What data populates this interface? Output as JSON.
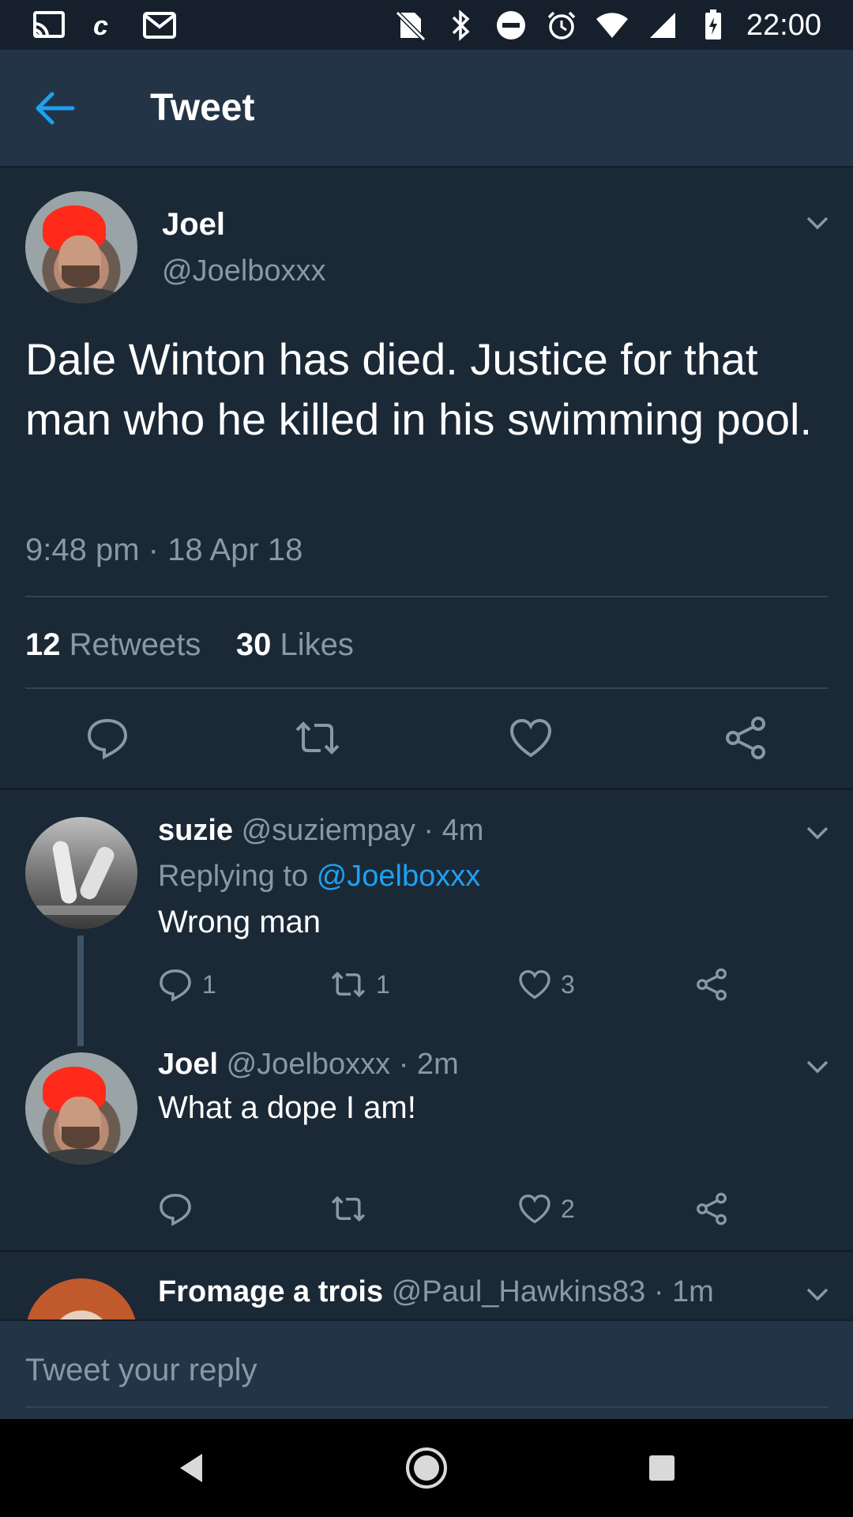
{
  "status_bar": {
    "time": "22:00",
    "left_icons": [
      "cast-icon",
      "c-app-icon",
      "gmail-icon"
    ],
    "right_icons": [
      "no-sim-icon",
      "bluetooth-icon",
      "do-not-disturb-icon",
      "alarm-icon",
      "wifi-icon",
      "signal-icon",
      "battery-charging-icon"
    ]
  },
  "app_bar": {
    "title": "Tweet",
    "back_icon": "back-arrow-icon",
    "accent": "#1da1f2"
  },
  "tweet": {
    "author_name": "Joel",
    "author_handle": "@Joelboxxx",
    "text": "Dale Winton has died. Justice for that man who he killed in his swimming pool.",
    "timestamp": "9:48 pm · 18 Apr 18",
    "retweets_count": "12",
    "retweets_label": "Retweets",
    "likes_count": "30",
    "likes_label": "Likes",
    "actions": [
      "reply-icon",
      "retweet-icon",
      "like-icon",
      "share-icon"
    ]
  },
  "replies": [
    {
      "name": "suzie",
      "handle": "@suziempay · 4m",
      "replying_prefix": "Replying to",
      "replying_to": "@Joelboxxx",
      "text": "Wrong man",
      "reply_count": "1",
      "retweet_count": "1",
      "like_count": "3"
    },
    {
      "name": "Joel",
      "handle": "@Joelboxxx · 2m",
      "text": "What a dope I am!",
      "reply_count": "",
      "retweet_count": "",
      "like_count": "2"
    },
    {
      "name": "Fromage a trois",
      "handle": "@Paul_Hawkins83 · 1m"
    }
  ],
  "compose": {
    "placeholder": "Tweet your reply"
  },
  "colors": {
    "background": "#1b2836",
    "header": "#243447",
    "secondary_text": "#8899a6",
    "link": "#1da1f2"
  }
}
